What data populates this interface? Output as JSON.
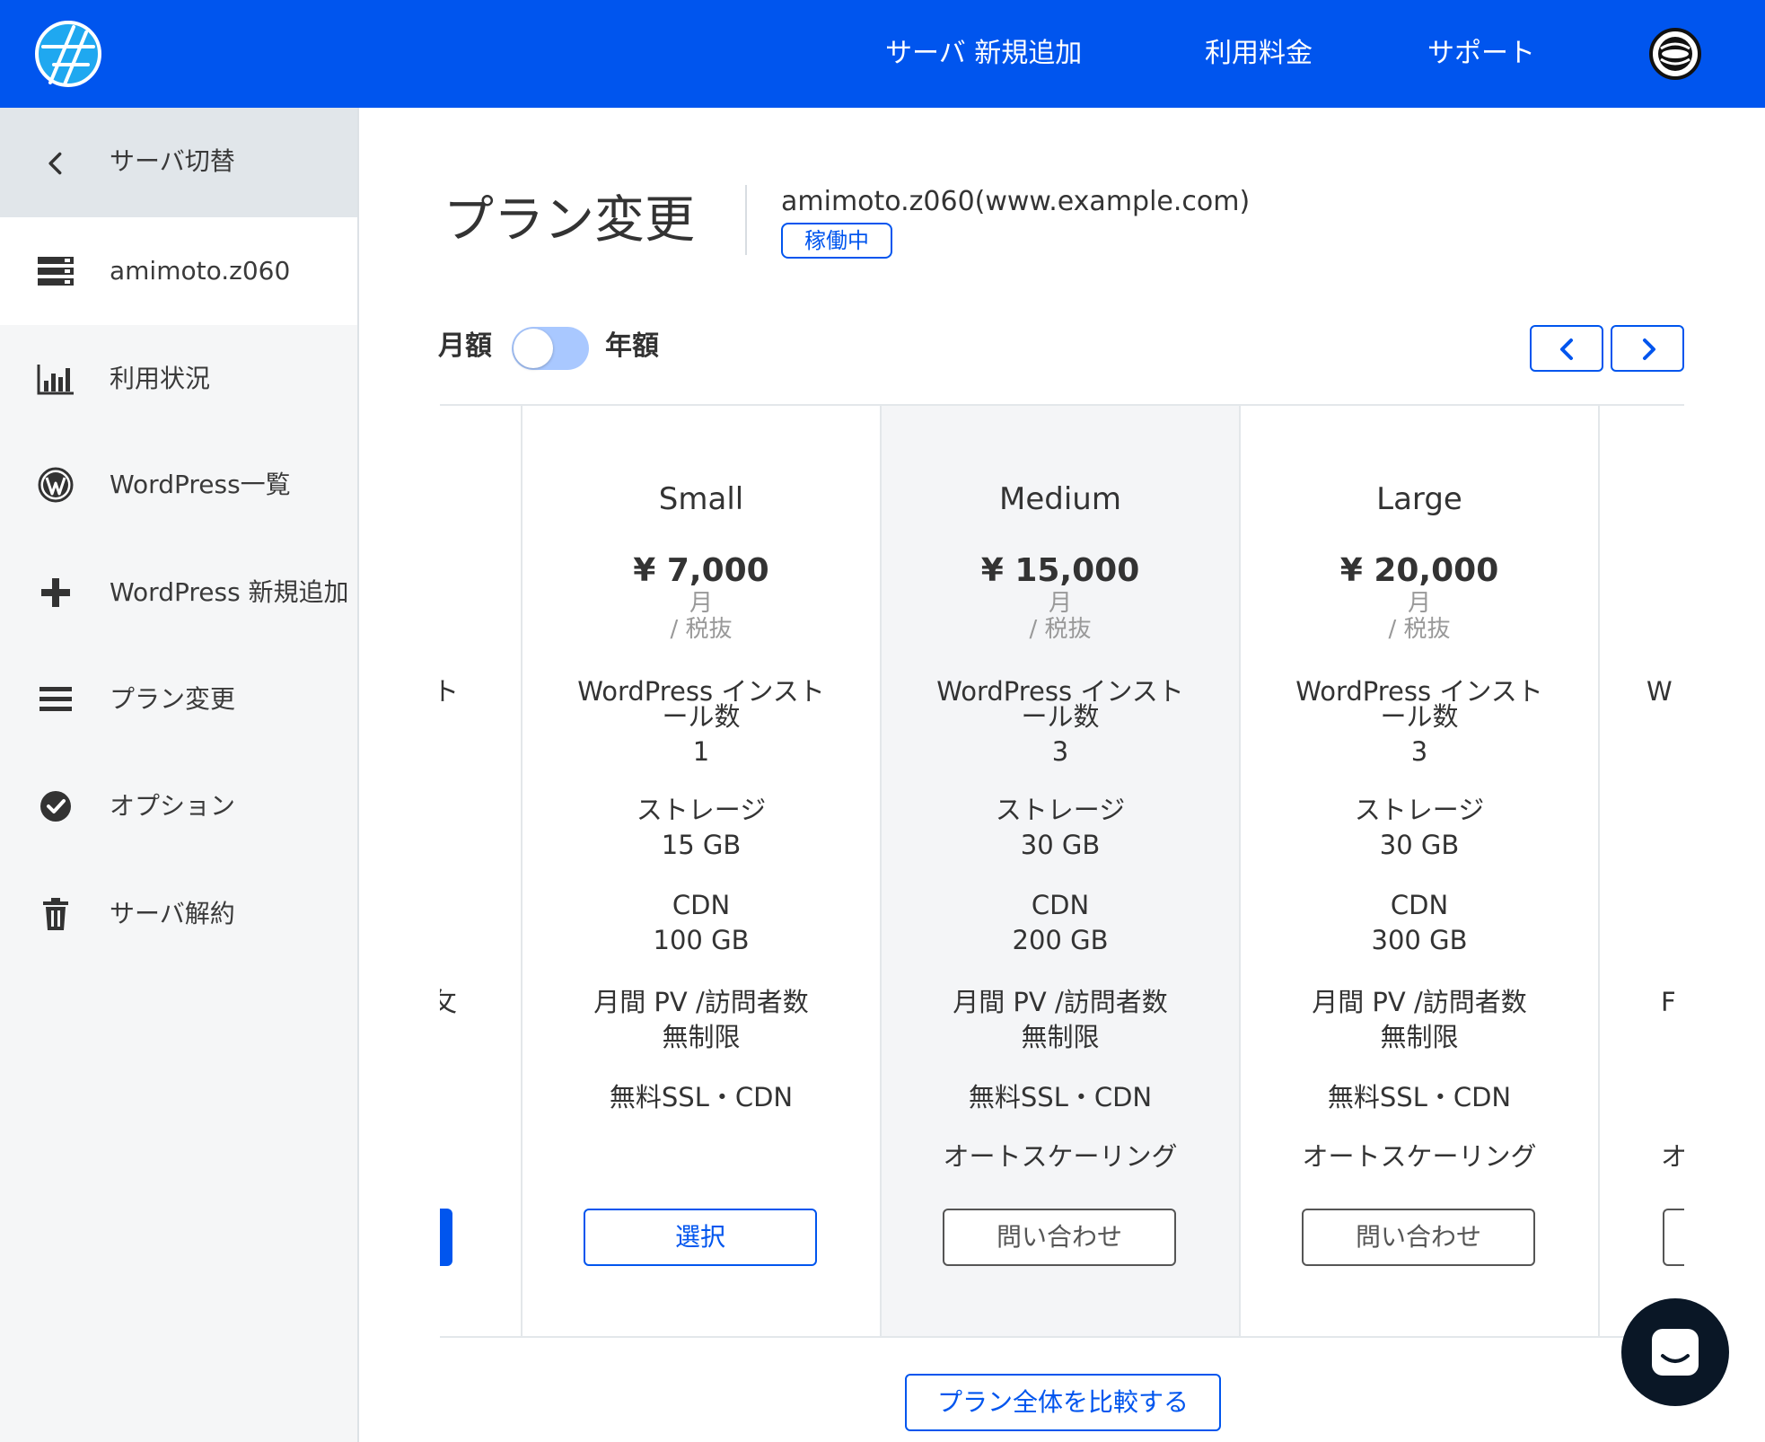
{
  "topbar": {
    "nav": [
      "サーバ 新規追加",
      "利用料金",
      "サポート"
    ]
  },
  "sidebar": {
    "back_label": "サーバ切替",
    "server_label": "amimoto.z060",
    "items": [
      {
        "label": "利用状況",
        "icon": "bar-chart-icon"
      },
      {
        "label": "WordPress一覧",
        "icon": "wordpress-icon"
      },
      {
        "label": "WordPress 新規追加",
        "icon": "plus-icon"
      },
      {
        "label": "プラン変更",
        "icon": "menu-icon"
      },
      {
        "label": "オプション",
        "icon": "check-circle-icon"
      },
      {
        "label": "サーバ解約",
        "icon": "trash-icon"
      }
    ]
  },
  "main": {
    "title": "プラン変更",
    "server": "amimoto.z060(www.example.com)",
    "status": "稼働中",
    "billing_monthly": "月額",
    "billing_yearly": "年額",
    "billing_yearly_selected": false,
    "compare_label": "プラン全体を比較する"
  },
  "plans": [
    {
      "name": "Small",
      "price": "¥ 7,000",
      "unit": "月",
      "tax": "/ 税抜",
      "install_label": "WordPress インスト",
      "install_label2": "ール数",
      "installs": "1",
      "storage_label": "ストレージ",
      "storage": "15 GB",
      "cdn_label": "CDN",
      "cdn": "100 GB",
      "pv_label": "月間 PV /訪問者数",
      "pv": "無制限",
      "ssl": "無料SSL・CDN",
      "autoscale": "",
      "button": "選択"
    },
    {
      "name": "Medium",
      "price": "¥ 15,000",
      "unit": "月",
      "tax": "/ 税抜",
      "install_label": "WordPress インスト",
      "install_label2": "ール数",
      "installs": "3",
      "storage_label": "ストレージ",
      "storage": "30 GB",
      "cdn_label": "CDN",
      "cdn": "200 GB",
      "pv_label": "月間 PV /訪問者数",
      "pv": "無制限",
      "ssl": "無料SSL・CDN",
      "autoscale": "オートスケーリング",
      "button": "問い合わせ"
    },
    {
      "name": "Large",
      "price": "¥ 20,000",
      "unit": "月",
      "tax": "/ 税抜",
      "install_label": "WordPress インスト",
      "install_label2": "ール数",
      "installs": "3",
      "storage_label": "ストレージ",
      "storage": "30 GB",
      "cdn_label": "CDN",
      "cdn": "300 GB",
      "pv_label": "月間 PV /訪問者数",
      "pv": "無制限",
      "ssl": "無料SSL・CDN",
      "autoscale": "オートスケーリング",
      "button": "問い合わせ"
    }
  ],
  "partial_left": {
    "install_fragment": "ト",
    "pv_fragment": "攵"
  },
  "partial_right": {
    "install_fragment": "W",
    "pv_fragment": "F",
    "autoscale_fragment": "オ"
  },
  "colors": {
    "brand": "#0055ee",
    "text": "#333333",
    "muted": "#999999",
    "highlight_card": "#f4f5f7"
  }
}
